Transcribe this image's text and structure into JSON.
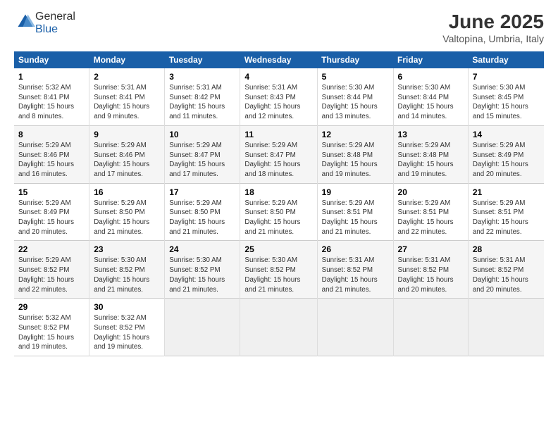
{
  "header": {
    "logo": {
      "general": "General",
      "blue": "Blue"
    },
    "title": "June 2025",
    "subtitle": "Valtopina, Umbria, Italy"
  },
  "calendar": {
    "days_of_week": [
      "Sunday",
      "Monday",
      "Tuesday",
      "Wednesday",
      "Thursday",
      "Friday",
      "Saturday"
    ],
    "weeks": [
      [
        null,
        null,
        null,
        null,
        null,
        null,
        null
      ]
    ]
  },
  "cells": {
    "empty": "",
    "w1": [
      {
        "num": "1",
        "info": "Sunrise: 5:32 AM\nSunset: 8:41 PM\nDaylight: 15 hours\nand 8 minutes."
      },
      {
        "num": "2",
        "info": "Sunrise: 5:31 AM\nSunset: 8:41 PM\nDaylight: 15 hours\nand 9 minutes."
      },
      {
        "num": "3",
        "info": "Sunrise: 5:31 AM\nSunset: 8:42 PM\nDaylight: 15 hours\nand 11 minutes."
      },
      {
        "num": "4",
        "info": "Sunrise: 5:31 AM\nSunset: 8:43 PM\nDaylight: 15 hours\nand 12 minutes."
      },
      {
        "num": "5",
        "info": "Sunrise: 5:30 AM\nSunset: 8:44 PM\nDaylight: 15 hours\nand 13 minutes."
      },
      {
        "num": "6",
        "info": "Sunrise: 5:30 AM\nSunset: 8:44 PM\nDaylight: 15 hours\nand 14 minutes."
      },
      {
        "num": "7",
        "info": "Sunrise: 5:30 AM\nSunset: 8:45 PM\nDaylight: 15 hours\nand 15 minutes."
      }
    ],
    "w2": [
      {
        "num": "8",
        "info": "Sunrise: 5:29 AM\nSunset: 8:46 PM\nDaylight: 15 hours\nand 16 minutes."
      },
      {
        "num": "9",
        "info": "Sunrise: 5:29 AM\nSunset: 8:46 PM\nDaylight: 15 hours\nand 17 minutes."
      },
      {
        "num": "10",
        "info": "Sunrise: 5:29 AM\nSunset: 8:47 PM\nDaylight: 15 hours\nand 17 minutes."
      },
      {
        "num": "11",
        "info": "Sunrise: 5:29 AM\nSunset: 8:47 PM\nDaylight: 15 hours\nand 18 minutes."
      },
      {
        "num": "12",
        "info": "Sunrise: 5:29 AM\nSunset: 8:48 PM\nDaylight: 15 hours\nand 19 minutes."
      },
      {
        "num": "13",
        "info": "Sunrise: 5:29 AM\nSunset: 8:48 PM\nDaylight: 15 hours\nand 19 minutes."
      },
      {
        "num": "14",
        "info": "Sunrise: 5:29 AM\nSunset: 8:49 PM\nDaylight: 15 hours\nand 20 minutes."
      }
    ],
    "w3": [
      {
        "num": "15",
        "info": "Sunrise: 5:29 AM\nSunset: 8:49 PM\nDaylight: 15 hours\nand 20 minutes."
      },
      {
        "num": "16",
        "info": "Sunrise: 5:29 AM\nSunset: 8:50 PM\nDaylight: 15 hours\nand 21 minutes."
      },
      {
        "num": "17",
        "info": "Sunrise: 5:29 AM\nSunset: 8:50 PM\nDaylight: 15 hours\nand 21 minutes."
      },
      {
        "num": "18",
        "info": "Sunrise: 5:29 AM\nSunset: 8:50 PM\nDaylight: 15 hours\nand 21 minutes."
      },
      {
        "num": "19",
        "info": "Sunrise: 5:29 AM\nSunset: 8:51 PM\nDaylight: 15 hours\nand 21 minutes."
      },
      {
        "num": "20",
        "info": "Sunrise: 5:29 AM\nSunset: 8:51 PM\nDaylight: 15 hours\nand 22 minutes."
      },
      {
        "num": "21",
        "info": "Sunrise: 5:29 AM\nSunset: 8:51 PM\nDaylight: 15 hours\nand 22 minutes."
      }
    ],
    "w4": [
      {
        "num": "22",
        "info": "Sunrise: 5:29 AM\nSunset: 8:52 PM\nDaylight: 15 hours\nand 22 minutes."
      },
      {
        "num": "23",
        "info": "Sunrise: 5:30 AM\nSunset: 8:52 PM\nDaylight: 15 hours\nand 21 minutes."
      },
      {
        "num": "24",
        "info": "Sunrise: 5:30 AM\nSunset: 8:52 PM\nDaylight: 15 hours\nand 21 minutes."
      },
      {
        "num": "25",
        "info": "Sunrise: 5:30 AM\nSunset: 8:52 PM\nDaylight: 15 hours\nand 21 minutes."
      },
      {
        "num": "26",
        "info": "Sunrise: 5:31 AM\nSunset: 8:52 PM\nDaylight: 15 hours\nand 21 minutes."
      },
      {
        "num": "27",
        "info": "Sunrise: 5:31 AM\nSunset: 8:52 PM\nDaylight: 15 hours\nand 20 minutes."
      },
      {
        "num": "28",
        "info": "Sunrise: 5:31 AM\nSunset: 8:52 PM\nDaylight: 15 hours\nand 20 minutes."
      }
    ],
    "w5": [
      {
        "num": "29",
        "info": "Sunrise: 5:32 AM\nSunset: 8:52 PM\nDaylight: 15 hours\nand 19 minutes."
      },
      {
        "num": "30",
        "info": "Sunrise: 5:32 AM\nSunset: 8:52 PM\nDaylight: 15 hours\nand 19 minutes."
      },
      null,
      null,
      null,
      null,
      null
    ]
  }
}
